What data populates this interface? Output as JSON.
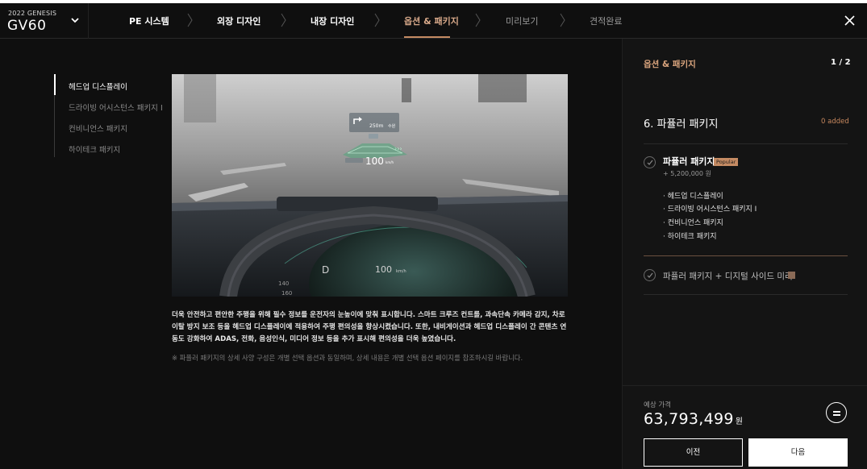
{
  "header": {
    "model_year": "2022 GENESIS",
    "model_name": "GV60",
    "steps": [
      {
        "label": "PE 시스템"
      },
      {
        "label": "외장 디자인"
      },
      {
        "label": "내장 디자인"
      },
      {
        "label": "옵션 & 패키지"
      },
      {
        "label": "미리보기"
      },
      {
        "label": "견적완료"
      }
    ],
    "active_step": "옵션 & 패키지",
    "close_icon": "close-icon"
  },
  "left_nav": {
    "items": [
      {
        "label": "헤드업 디스플레이"
      },
      {
        "label": "드라이빙 어시스턴스 패키지 I"
      },
      {
        "label": "컨비니언스 패키지"
      },
      {
        "label": "하이테크 패키지"
      }
    ],
    "active": "헤드업 디스플레이"
  },
  "hero_image": {
    "hud_distance": "250m",
    "hud_sub": "수원",
    "hud_speed": "100",
    "hud_speed_unit": "km/h",
    "cluster_gear": "D",
    "cluster_speed": "100",
    "cluster_unit": "km/h",
    "cluster_tick_1": "140",
    "cluster_tick_2": "160"
  },
  "description": {
    "text": "더욱 안전하고 편안한 주행을 위해 필수 정보를 운전자의 눈높이에 맞춰 표시합니다. 스마트 크루즈 컨트롤, 과속단속 카메라 감지, 차로 이탈 방지 보조 등을 헤드업 디스플레이에 적용하여 주행 편의성을 향상시켰습니다. 또한, 내비게이션과 헤드업 디스플레이 간 콘텐츠 연동도 강화하여 ADAS, 전화, 음성인식, 미디어 정보 등을 추가 표시해 편의성을 더욱 높였습니다.",
    "note": "※ 파퓰러 패키지의 상세 사양 구성은 개별 선택 옵션과 동일하며, 상세 내용은 개별 선택 옵션 페이지를 참조하시길 바랍니다."
  },
  "panel": {
    "title": "옵션 & 패키지",
    "page": "1 / 2",
    "section_title": "6. 파퓰러 패키지",
    "added": "0 added",
    "package1": {
      "name": "파퓰러 패키지",
      "badge": "Popular",
      "price": "+ 5,200,000 원",
      "items": [
        "· 헤드업 디스플레이",
        "· 드라이빙 어시스턴스 패키지 I",
        "· 컨비니언스 패키지",
        "· 하이테크 패키지"
      ]
    },
    "package2": {
      "name": "파퓰러 패키지 + 디지털 사이드 미러"
    },
    "price_label": "예상 가격",
    "price_value": "63,793,499",
    "price_unit": "원",
    "prev_label": "이전",
    "next_label": "다음"
  },
  "colors": {
    "accent": "#c58b63",
    "background": "#0f0f0f",
    "panel": "#141414"
  }
}
